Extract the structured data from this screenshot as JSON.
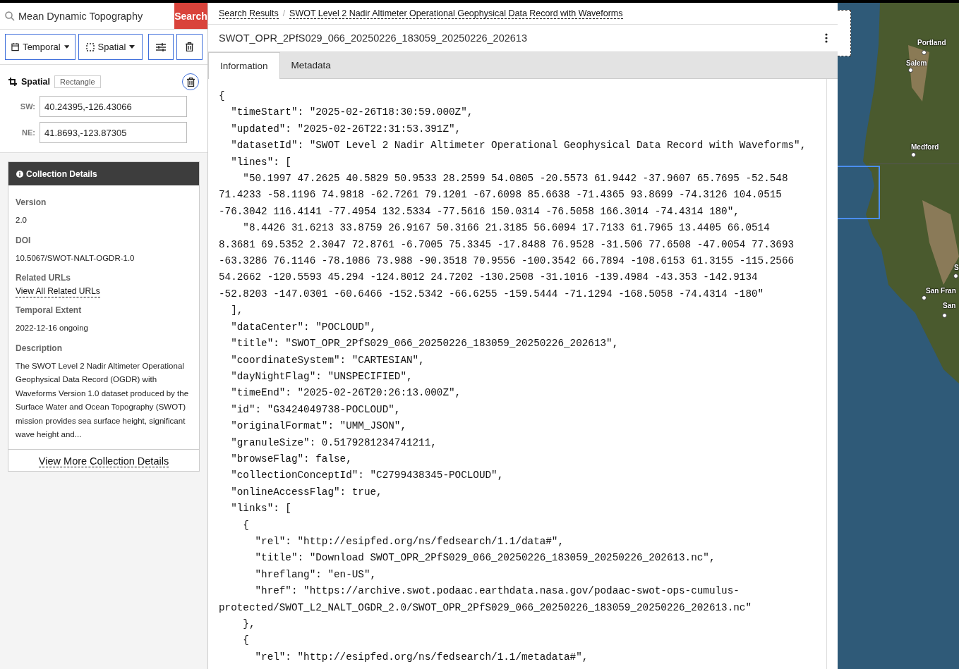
{
  "search": {
    "value": "Mean Dynamic Topography",
    "button": "Search"
  },
  "filters": [
    {
      "kind": "temporal",
      "label": "Temporal"
    },
    {
      "kind": "spatial",
      "label": "Spatial"
    },
    {
      "kind": "options"
    },
    {
      "kind": "clear"
    }
  ],
  "spatial": {
    "title": "Spatial",
    "type": "Rectangle",
    "fields": [
      {
        "label": "SW:",
        "value": "40.24395,-126.43066"
      },
      {
        "label": "NE:",
        "value": "41.8693,-123.87305"
      }
    ]
  },
  "collection_details": {
    "title": "Collection Details",
    "sections": [
      {
        "heading": "Version",
        "value": "2.0"
      },
      {
        "heading": "DOI",
        "value": "10.5067/SWOT-NALT-OGDR-1.0"
      },
      {
        "heading": "Related URLs",
        "link": "View All Related URLs"
      },
      {
        "heading": "Temporal Extent",
        "value": "2022-12-16 ongoing"
      },
      {
        "heading": "Description",
        "value": "The SWOT Level 2 Nadir Altimeter Operational Geophysical Data Record (OGDR) with Waveforms Version 1.0 dataset produced by the Surface Water and Ocean Topography (SWOT) mission provides sea surface height, significant wave height and..."
      }
    ],
    "footer_link": "View More Collection Details"
  },
  "breadcrumbs": {
    "items": [
      "Search Results",
      "SWOT Level 2 Nadir Altimeter Operational Geophysical Data Record with Waveforms"
    ],
    "separator": "/"
  },
  "granule": {
    "title": "SWOT_OPR_2PfS029_066_20250226_183059_20250226_202613"
  },
  "tabs": [
    {
      "label": "Information",
      "selected": true
    },
    {
      "label": "Metadata",
      "selected": false
    }
  ],
  "code_lines": [
    "{",
    "  \"timeStart\": \"2025-02-26T18:30:59.000Z\",",
    "  \"updated\": \"2025-02-26T22:31:53.391Z\",",
    "  \"datasetId\": \"SWOT Level 2 Nadir Altimeter Operational Geophysical Data Record with Waveforms\",",
    "  \"lines\": [",
    "    \"50.1997 47.2625 40.5829 50.9533 28.2599 54.0805 -20.5573 61.9442 -37.9607 65.7695 -52.548",
    "71.4233 -58.1196 74.9818 -62.7261 79.1201 -67.6098 85.6638 -71.4365 93.8699 -74.3126 104.0515",
    "-76.3042 116.4141 -77.4954 132.5334 -77.5616 150.0314 -76.5058 166.3014 -74.4314 180\",",
    "    \"8.4426 31.6213 33.8759 26.9167 50.3166 21.3185 56.6094 17.7133 61.7965 13.4405 66.0514",
    "8.3681 69.5352 2.3047 72.8761 -6.7005 75.3345 -17.8488 76.9528 -31.506 77.6508 -47.0054 77.3693",
    "-63.3286 76.1146 -78.1086 73.988 -90.3518 70.9556 -100.3542 66.7894 -108.6153 61.3155 -115.2566",
    "54.2662 -120.5593 45.294 -124.8012 24.7202 -130.2508 -31.1016 -139.4984 -43.353 -142.9134",
    "-52.8203 -147.0301 -60.6466 -152.5342 -66.6255 -159.5444 -71.1294 -168.5058 -74.4314 -180\"",
    "  ],",
    "  \"dataCenter\": \"POCLOUD\",",
    "  \"title\": \"SWOT_OPR_2PfS029_066_20250226_183059_20250226_202613\",",
    "  \"coordinateSystem\": \"CARTESIAN\",",
    "  \"dayNightFlag\": \"UNSPECIFIED\",",
    "  \"timeEnd\": \"2025-02-26T20:26:13.000Z\",",
    "  \"id\": \"G3424049738-POCLOUD\",",
    "  \"originalFormat\": \"UMM_JSON\",",
    "  \"granuleSize\": 0.5179281234741211,",
    "  \"browseFlag\": false,",
    "  \"collectionConceptId\": \"C2799438345-POCLOUD\",",
    "  \"onlineAccessFlag\": true,",
    "  \"links\": [",
    "    {",
    "      \"rel\": \"http://esipfed.org/ns/fedsearch/1.1/data#\",",
    "      \"title\": \"Download SWOT_OPR_2PfS029_066_20250226_183059_20250226_202613.nc\",",
    "      \"hreflang\": \"en-US\",",
    "      \"href\": \"https://archive.swot.podaac.earthdata.nasa.gov/podaac-swot-ops-cumulus-",
    "protected/SWOT_L2_NALT_OGDR_2.0/SWOT_OPR_2PfS029_066_20250226_183059_20250226_202613.nc\"",
    "    },",
    "    {",
    "      \"rel\": \"http://esipfed.org/ns/fedsearch/1.1/metadata#\","
  ],
  "map": {
    "labels": [
      {
        "text": "Portland"
      },
      {
        "text": "Salem"
      },
      {
        "text": "Medford"
      },
      {
        "text": "S"
      },
      {
        "text": "San Fran"
      },
      {
        "text": "San"
      }
    ]
  }
}
